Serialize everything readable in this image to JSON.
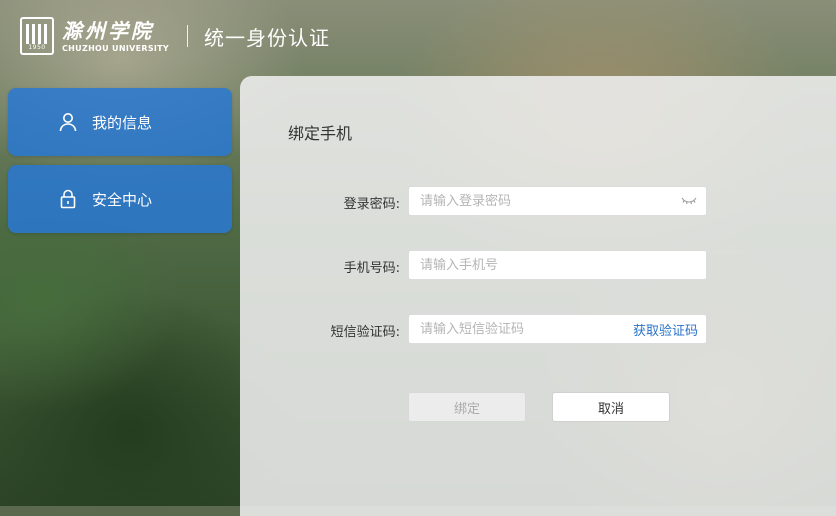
{
  "header": {
    "logo_cn": "滁州学院",
    "logo_en": "CHUZHOU UNIVERSITY",
    "logo_year": "1950",
    "system_title": "统一身份认证"
  },
  "sidebar": {
    "items": [
      {
        "label": "我的信息",
        "icon": "user-icon"
      },
      {
        "label": "安全中心",
        "icon": "lock-icon"
      }
    ]
  },
  "form": {
    "title": "绑定手机",
    "password": {
      "label": "登录密码:",
      "placeholder": "请输入登录密码",
      "value": ""
    },
    "phone": {
      "label": "手机号码:",
      "placeholder": "请输入手机号",
      "value": ""
    },
    "sms": {
      "label": "短信验证码:",
      "placeholder": "请输入短信验证码",
      "value": "",
      "action": "获取验证码"
    },
    "bind_label": "绑定",
    "cancel_label": "取消"
  },
  "colors": {
    "nav_bg": "#2878d2",
    "link": "#2a73c8"
  }
}
